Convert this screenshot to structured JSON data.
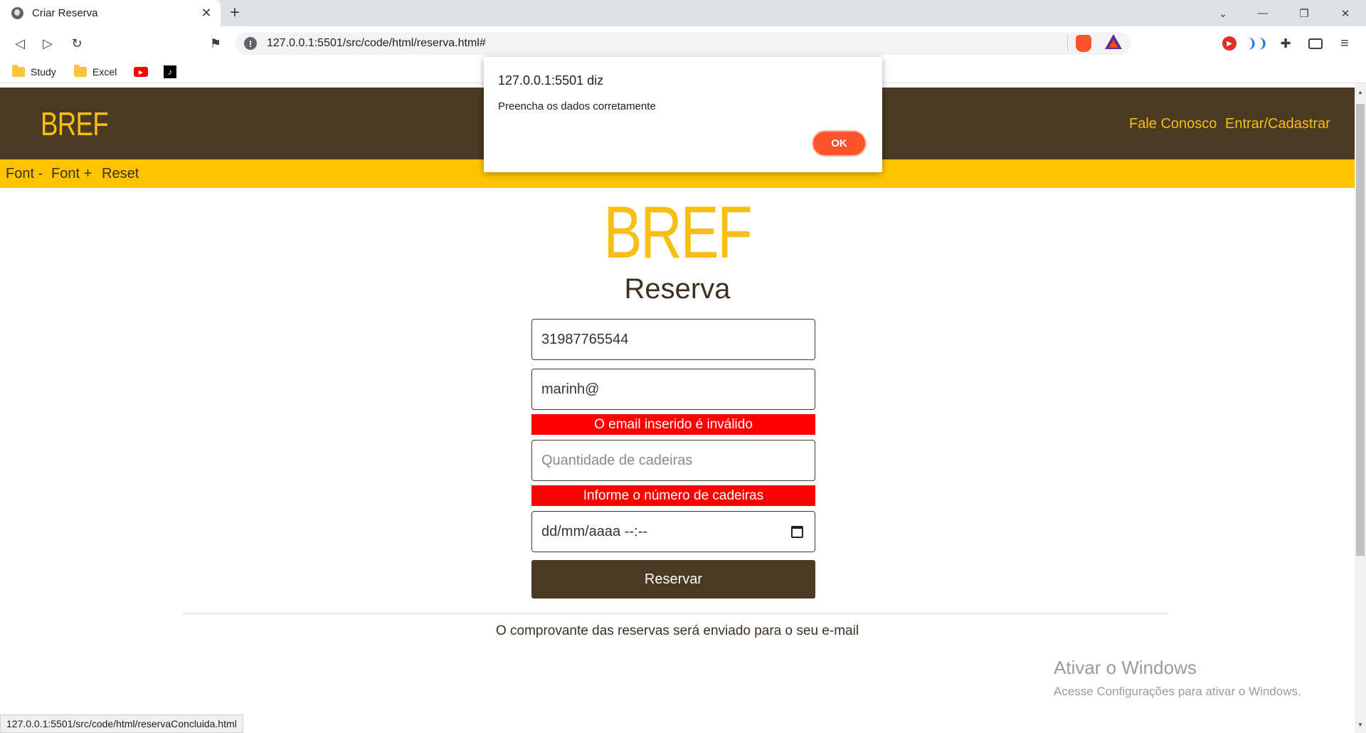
{
  "browser": {
    "tab_title": "Criar Reserva",
    "tab_close": "✕",
    "new_tab": "+",
    "window_controls": {
      "minimize": "—",
      "restore": "❐",
      "close": "✕",
      "tab_search": "⌄"
    },
    "url": "127.0.0.1:5501/src/code/html/reserva.html#",
    "bookmarks": [
      {
        "label": "Study",
        "icon": "folder-icon"
      },
      {
        "label": "Excel",
        "icon": "folder-icon"
      },
      {
        "label": "",
        "icon": "youtube-icon"
      },
      {
        "label": "",
        "icon": "tiktok-icon"
      }
    ],
    "status_url": "127.0.0.1:5501/src/code/html/reservaConcluida.html"
  },
  "header": {
    "logo": "BREF",
    "links": [
      "Fale Conosco",
      "Entrar/Cadastrar"
    ],
    "colors": {
      "background": "#4a3a21",
      "accent": "#f8be16"
    }
  },
  "accessibility_bar": {
    "buttons": [
      "Font -",
      "Font +",
      "Reset"
    ],
    "color": "#ffc400"
  },
  "form": {
    "title": "BREF",
    "subtitle": "Reserva",
    "phone_value": "31987765544",
    "email_value": "marinh@",
    "email_error": "O email inserido é inválido",
    "chairs_placeholder": "Quantidade de cadeiras",
    "chairs_error": "Informe o número de cadeiras",
    "datetime_value": "dd/mm/aaaa --:--",
    "submit_label": "Reservar",
    "footnote": "O comprovante das reservas será enviado para o seu e-mail",
    "error_color": "#ff0000"
  },
  "dialog": {
    "title": "127.0.0.1:5501 diz",
    "message": "Preencha os dados corretamente",
    "ok_label": "OK"
  },
  "watermark": {
    "title": "Ativar o Windows",
    "subtitle": "Acesse Configurações para ativar o Windows."
  }
}
